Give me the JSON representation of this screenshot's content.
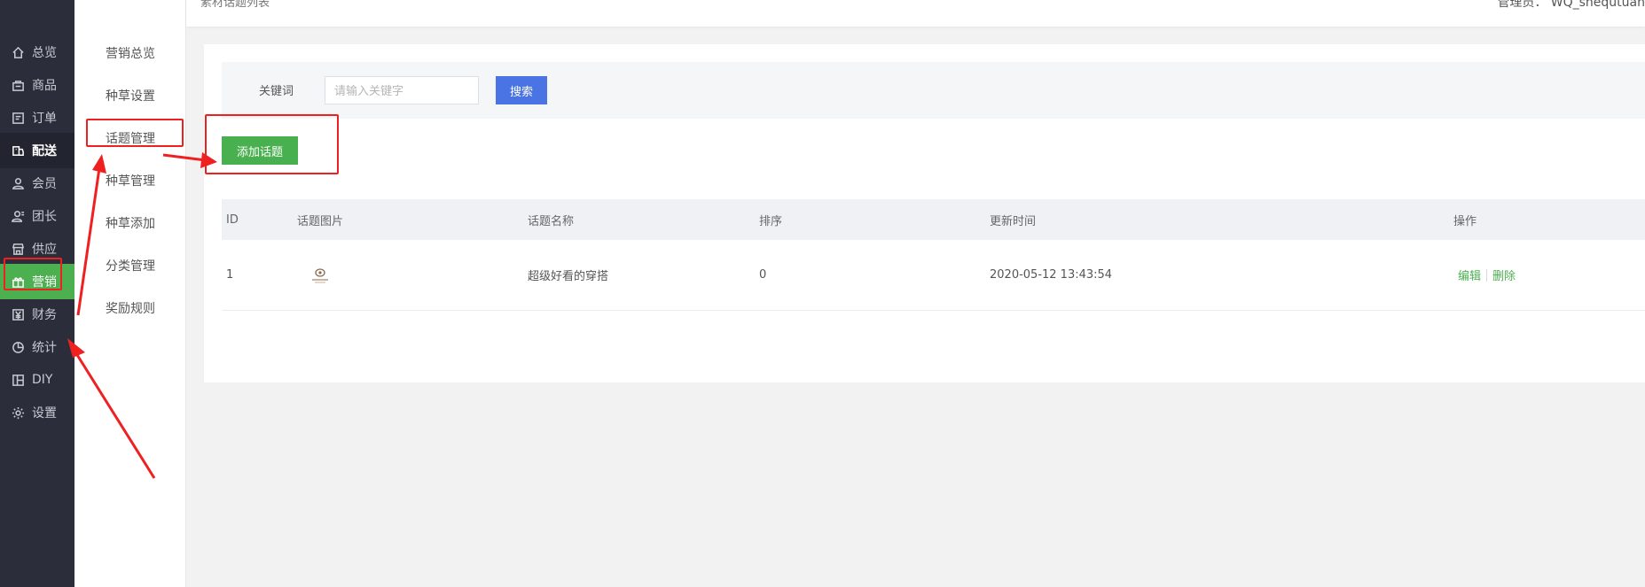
{
  "topbar": {
    "breadcrumb": "素材话题列表",
    "admin": "管理员： WQ_shequtuan"
  },
  "sidebar": {
    "items": [
      {
        "label": "总览",
        "icon": "home-icon"
      },
      {
        "label": "商品",
        "icon": "goods-icon"
      },
      {
        "label": "订单",
        "icon": "order-icon"
      },
      {
        "label": "配送",
        "icon": "delivery-icon"
      },
      {
        "label": "会员",
        "icon": "member-icon"
      },
      {
        "label": "团长",
        "icon": "leader-icon"
      },
      {
        "label": "供应",
        "icon": "supply-icon"
      },
      {
        "label": "营销",
        "icon": "gift-icon"
      },
      {
        "label": "财务",
        "icon": "finance-icon"
      },
      {
        "label": "统计",
        "icon": "pie-chart-icon"
      },
      {
        "label": "DIY",
        "icon": "layout-icon"
      },
      {
        "label": "设置",
        "icon": "gear-icon"
      }
    ],
    "active": "营销",
    "bold": "配送"
  },
  "submenu": {
    "items": [
      {
        "label": "营销总览"
      },
      {
        "label": "种草设置"
      },
      {
        "label": "话题管理"
      },
      {
        "label": "种草管理"
      },
      {
        "label": "种草添加"
      },
      {
        "label": "分类管理"
      },
      {
        "label": "奖励规则"
      }
    ]
  },
  "search": {
    "label": "关键词",
    "placeholder": "请输入关键字",
    "value": "",
    "button": "搜索"
  },
  "add_button": "添加话题",
  "table": {
    "headers": [
      "ID",
      "话题图片",
      "话题名称",
      "排序",
      "更新时间",
      "操作"
    ],
    "rows": [
      {
        "id": "1",
        "image": "topic-thumbnail",
        "name": "超级好看的穿搭",
        "sort": "0",
        "updated": "2020-05-12 13:43:54",
        "edit": "编辑",
        "delete": "删除"
      }
    ]
  },
  "colors": {
    "sidebar_bg": "#2b2d3b",
    "active_green": "#4caf50",
    "search_blue": "#4a74e3",
    "annotation_red": "#ef2020"
  }
}
